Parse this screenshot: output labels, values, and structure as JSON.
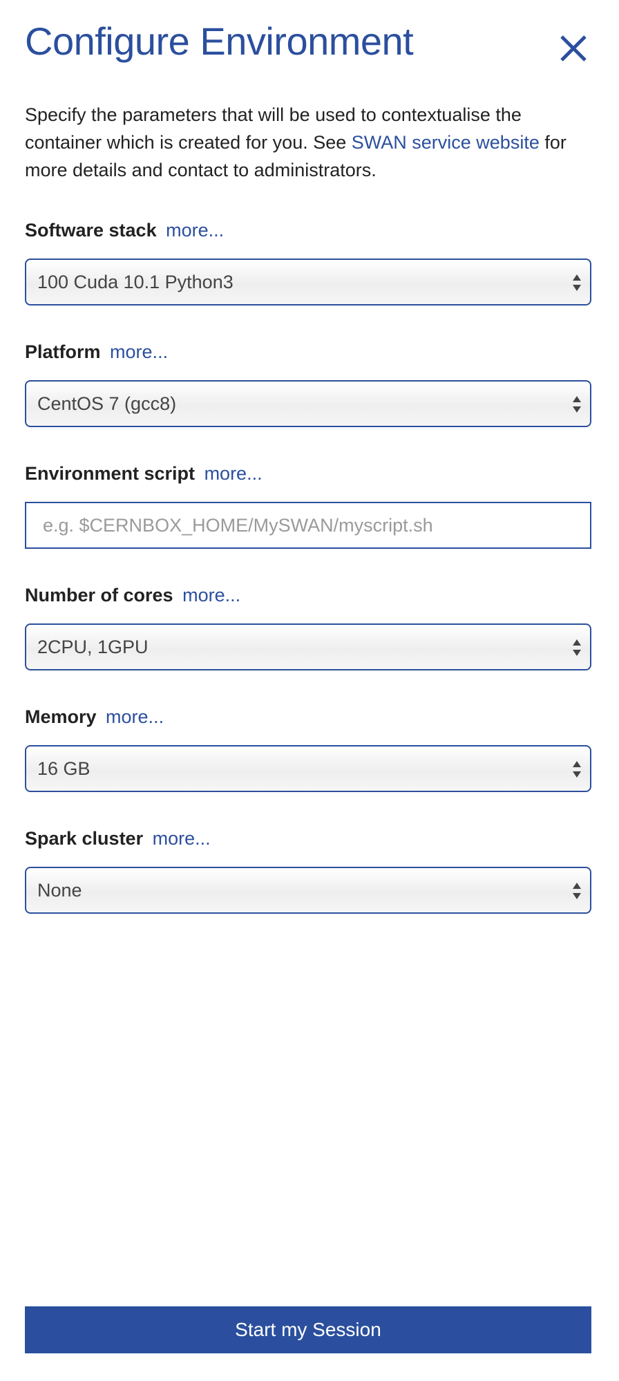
{
  "header": {
    "title": "Configure Environment",
    "close_icon": "close-icon"
  },
  "intro": {
    "text_before": "Specify the parameters that will be used to contextualise the container which is created for you. See ",
    "link_text": "SWAN service website",
    "text_after": " for more details and contact to administrators."
  },
  "fields": {
    "software_stack": {
      "label": "Software stack",
      "more": "more...",
      "value": "100 Cuda 10.1 Python3"
    },
    "platform": {
      "label": "Platform",
      "more": "more...",
      "value": "CentOS 7 (gcc8)"
    },
    "environment_script": {
      "label": "Environment script",
      "more": "more...",
      "value": "",
      "placeholder": "e.g. $CERNBOX_HOME/MySWAN/myscript.sh"
    },
    "number_of_cores": {
      "label": "Number of cores",
      "more": "more...",
      "value": "2CPU, 1GPU"
    },
    "memory": {
      "label": "Memory",
      "more": "more...",
      "value": "16 GB"
    },
    "spark_cluster": {
      "label": "Spark cluster",
      "more": "more...",
      "value": "None"
    }
  },
  "actions": {
    "start_label": "Start my Session"
  },
  "colors": {
    "accent": "#2b4f9e",
    "text": "#222222",
    "placeholder": "#9a9a9a"
  }
}
